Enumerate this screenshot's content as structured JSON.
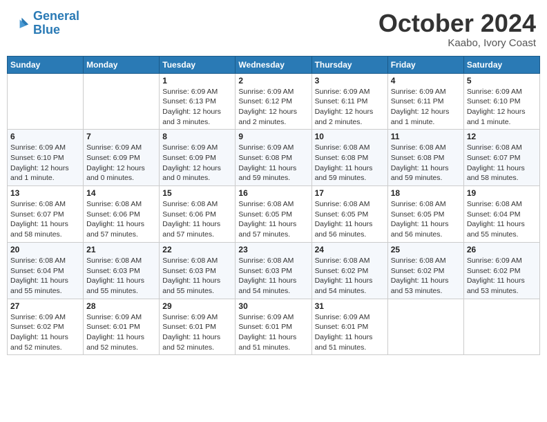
{
  "header": {
    "logo_line1": "General",
    "logo_line2": "Blue",
    "month": "October 2024",
    "location": "Kaabo, Ivory Coast"
  },
  "weekdays": [
    "Sunday",
    "Monday",
    "Tuesday",
    "Wednesday",
    "Thursday",
    "Friday",
    "Saturday"
  ],
  "weeks": [
    [
      {
        "day": "",
        "info": ""
      },
      {
        "day": "",
        "info": ""
      },
      {
        "day": "1",
        "info": "Sunrise: 6:09 AM\nSunset: 6:13 PM\nDaylight: 12 hours and 3 minutes."
      },
      {
        "day": "2",
        "info": "Sunrise: 6:09 AM\nSunset: 6:12 PM\nDaylight: 12 hours and 2 minutes."
      },
      {
        "day": "3",
        "info": "Sunrise: 6:09 AM\nSunset: 6:11 PM\nDaylight: 12 hours and 2 minutes."
      },
      {
        "day": "4",
        "info": "Sunrise: 6:09 AM\nSunset: 6:11 PM\nDaylight: 12 hours and 1 minute."
      },
      {
        "day": "5",
        "info": "Sunrise: 6:09 AM\nSunset: 6:10 PM\nDaylight: 12 hours and 1 minute."
      }
    ],
    [
      {
        "day": "6",
        "info": "Sunrise: 6:09 AM\nSunset: 6:10 PM\nDaylight: 12 hours and 1 minute."
      },
      {
        "day": "7",
        "info": "Sunrise: 6:09 AM\nSunset: 6:09 PM\nDaylight: 12 hours and 0 minutes."
      },
      {
        "day": "8",
        "info": "Sunrise: 6:09 AM\nSunset: 6:09 PM\nDaylight: 12 hours and 0 minutes."
      },
      {
        "day": "9",
        "info": "Sunrise: 6:09 AM\nSunset: 6:08 PM\nDaylight: 11 hours and 59 minutes."
      },
      {
        "day": "10",
        "info": "Sunrise: 6:08 AM\nSunset: 6:08 PM\nDaylight: 11 hours and 59 minutes."
      },
      {
        "day": "11",
        "info": "Sunrise: 6:08 AM\nSunset: 6:08 PM\nDaylight: 11 hours and 59 minutes."
      },
      {
        "day": "12",
        "info": "Sunrise: 6:08 AM\nSunset: 6:07 PM\nDaylight: 11 hours and 58 minutes."
      }
    ],
    [
      {
        "day": "13",
        "info": "Sunrise: 6:08 AM\nSunset: 6:07 PM\nDaylight: 11 hours and 58 minutes."
      },
      {
        "day": "14",
        "info": "Sunrise: 6:08 AM\nSunset: 6:06 PM\nDaylight: 11 hours and 57 minutes."
      },
      {
        "day": "15",
        "info": "Sunrise: 6:08 AM\nSunset: 6:06 PM\nDaylight: 11 hours and 57 minutes."
      },
      {
        "day": "16",
        "info": "Sunrise: 6:08 AM\nSunset: 6:05 PM\nDaylight: 11 hours and 57 minutes."
      },
      {
        "day": "17",
        "info": "Sunrise: 6:08 AM\nSunset: 6:05 PM\nDaylight: 11 hours and 56 minutes."
      },
      {
        "day": "18",
        "info": "Sunrise: 6:08 AM\nSunset: 6:05 PM\nDaylight: 11 hours and 56 minutes."
      },
      {
        "day": "19",
        "info": "Sunrise: 6:08 AM\nSunset: 6:04 PM\nDaylight: 11 hours and 55 minutes."
      }
    ],
    [
      {
        "day": "20",
        "info": "Sunrise: 6:08 AM\nSunset: 6:04 PM\nDaylight: 11 hours and 55 minutes."
      },
      {
        "day": "21",
        "info": "Sunrise: 6:08 AM\nSunset: 6:03 PM\nDaylight: 11 hours and 55 minutes."
      },
      {
        "day": "22",
        "info": "Sunrise: 6:08 AM\nSunset: 6:03 PM\nDaylight: 11 hours and 55 minutes."
      },
      {
        "day": "23",
        "info": "Sunrise: 6:08 AM\nSunset: 6:03 PM\nDaylight: 11 hours and 54 minutes."
      },
      {
        "day": "24",
        "info": "Sunrise: 6:08 AM\nSunset: 6:02 PM\nDaylight: 11 hours and 54 minutes."
      },
      {
        "day": "25",
        "info": "Sunrise: 6:08 AM\nSunset: 6:02 PM\nDaylight: 11 hours and 53 minutes."
      },
      {
        "day": "26",
        "info": "Sunrise: 6:09 AM\nSunset: 6:02 PM\nDaylight: 11 hours and 53 minutes."
      }
    ],
    [
      {
        "day": "27",
        "info": "Sunrise: 6:09 AM\nSunset: 6:02 PM\nDaylight: 11 hours and 52 minutes."
      },
      {
        "day": "28",
        "info": "Sunrise: 6:09 AM\nSunset: 6:01 PM\nDaylight: 11 hours and 52 minutes."
      },
      {
        "day": "29",
        "info": "Sunrise: 6:09 AM\nSunset: 6:01 PM\nDaylight: 11 hours and 52 minutes."
      },
      {
        "day": "30",
        "info": "Sunrise: 6:09 AM\nSunset: 6:01 PM\nDaylight: 11 hours and 51 minutes."
      },
      {
        "day": "31",
        "info": "Sunrise: 6:09 AM\nSunset: 6:01 PM\nDaylight: 11 hours and 51 minutes."
      },
      {
        "day": "",
        "info": ""
      },
      {
        "day": "",
        "info": ""
      }
    ]
  ]
}
